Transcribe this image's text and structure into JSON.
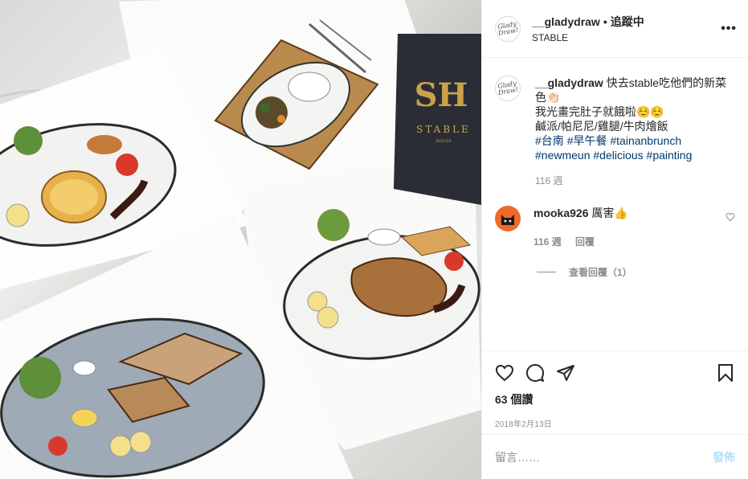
{
  "image": {
    "stable_logo": "STABLE",
    "stable_logo_sub": "HOUSE"
  },
  "header": {
    "username": "__gladydraw",
    "separator": "•",
    "follow_label": "追蹤中",
    "location": "STABLE",
    "more_label": "•••",
    "avatar_text": "Glady Draw!"
  },
  "caption": {
    "username": "__gladydraw",
    "line1": "快去stable吃他們的新菜色👏🏻",
    "line2": "我光畫完肚子就餓啦☺️☺️",
    "line3": "鹹派/帕尼尼/雞腿/牛肉燴飯",
    "hashtags_line1": [
      "#台南",
      "#早午餐",
      "#tainanbrunch"
    ],
    "hashtags_line2": [
      "#newmeun",
      "#delicious",
      "#painting"
    ],
    "age": "116 週"
  },
  "comment": {
    "username": "mooka926",
    "text": "厲害👍",
    "age": "116 週",
    "reply_label": "回覆",
    "view_replies": "查看回覆（1）"
  },
  "footer": {
    "likes": "63 個讚",
    "date": "2018年2月13日",
    "comment_placeholder": "留言……",
    "post_label": "發佈"
  },
  "colors": {
    "link": "#00376b",
    "muted": "#8e8e8e",
    "post_disabled": "#b2dffc",
    "commenter_avatar": "#ee6a2c"
  }
}
